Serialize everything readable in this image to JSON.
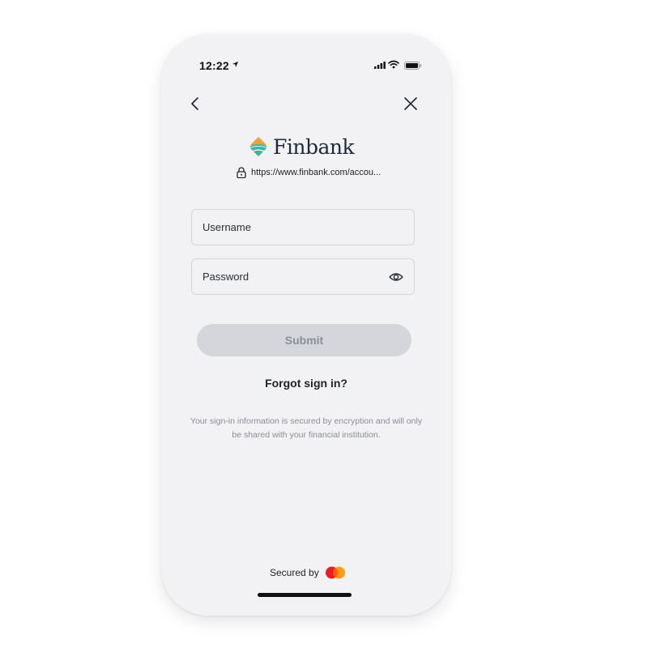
{
  "status_bar": {
    "time": "12:22"
  },
  "nav": {
    "back_icon": "chevron-left-icon",
    "close_icon": "close-icon"
  },
  "brand": {
    "name": "Finbank",
    "url": "https://www.finbank.com/accou...",
    "colors": {
      "orange": "#f0a23a",
      "teal": "#3bb3a0",
      "navy": "#1f2b3a"
    }
  },
  "form": {
    "username_placeholder": "Username",
    "password_placeholder": "Password",
    "submit_label": "Submit"
  },
  "links": {
    "forgot": "Forgot sign in?"
  },
  "notice": "Your sign-in information is secured by encryption and will only be shared with your financial institution.",
  "footer": {
    "secured_by": "Secured by"
  }
}
